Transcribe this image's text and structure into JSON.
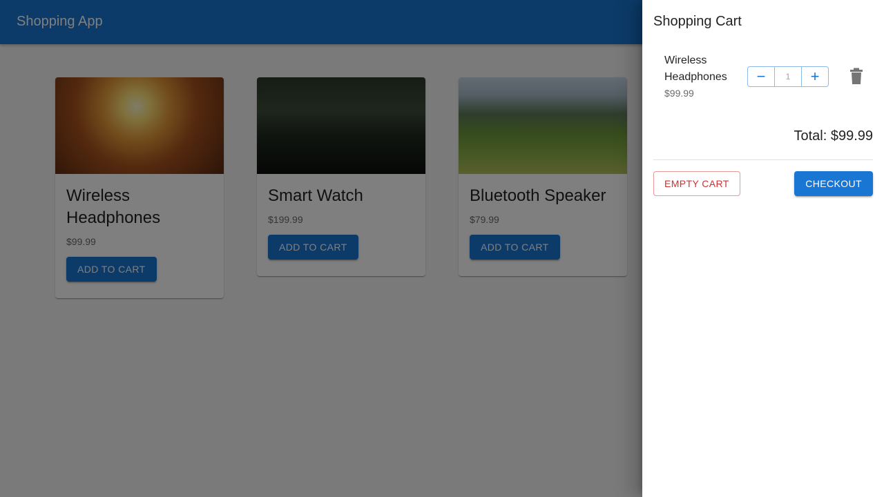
{
  "appbar": {
    "title": "Shopping App"
  },
  "products": [
    {
      "name": "Wireless Headphones",
      "price": "$99.99",
      "button_label": "ADD TO CART"
    },
    {
      "name": "Smart Watch",
      "price": "$199.99",
      "button_label": "ADD TO CART"
    },
    {
      "name": "Bluetooth Speaker",
      "price": "$79.99",
      "button_label": "ADD TO CART"
    }
  ],
  "cart": {
    "title": "Shopping Cart",
    "items": [
      {
        "name": "Wireless Headphones",
        "price": "$99.99",
        "quantity": "1",
        "minus_label": "−",
        "plus_label": "+"
      }
    ],
    "total": "Total: $99.99",
    "empty_label": "EMPTY CART",
    "checkout_label": "CHECKOUT"
  },
  "colors": {
    "primary": "#1976d2",
    "error": "#d32f2f"
  },
  "icons": {
    "delete": "trash-icon"
  }
}
